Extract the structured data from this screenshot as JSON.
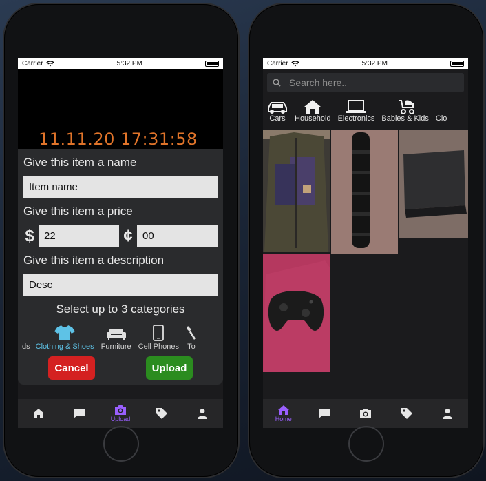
{
  "left_phone": {
    "status": {
      "carrier": "Carrier",
      "time": "5:32 PM"
    },
    "camera_timestamp": "11.11.20 17:31:58",
    "form": {
      "name_label": "Give this item a name",
      "name_value": "Item name",
      "price_label": "Give this item a price",
      "dollar_symbol": "$",
      "dollar_value": "22",
      "cent_symbol": "¢",
      "cent_value": "00",
      "desc_label": "Give this item a description",
      "desc_value": "Desc",
      "categories_label": "Select up to 3 categories",
      "categories": [
        {
          "label": "ds",
          "icon": "none"
        },
        {
          "label": "Clothing & Shoes",
          "icon": "shirt-icon",
          "selected": true
        },
        {
          "label": "Furniture",
          "icon": "sofa-icon"
        },
        {
          "label": "Cell Phones",
          "icon": "phone-icon"
        },
        {
          "label": "To",
          "icon": "tool-icon"
        }
      ],
      "cancel_label": "Cancel",
      "upload_label": "Upload"
    },
    "tabbar": {
      "active_label": "Upload"
    }
  },
  "right_phone": {
    "status": {
      "carrier": "Carrier",
      "time": "5:32 PM"
    },
    "search_placeholder": "Search here..",
    "categories": [
      {
        "label": "Cars",
        "icon": "car-icon"
      },
      {
        "label": "Household",
        "icon": "house-icon"
      },
      {
        "label": "Electronics",
        "icon": "laptop-icon"
      },
      {
        "label": "Babies & Kids",
        "icon": "stroller-icon"
      },
      {
        "label": "Clo",
        "icon": "none"
      }
    ],
    "listings": [
      {
        "subject": "jacket",
        "colors": [
          "#4a4636",
          "#3a3550"
        ]
      },
      {
        "subject": "foam-roller",
        "colors": [
          "#9a7b74",
          "#111111"
        ]
      },
      {
        "subject": "laptop",
        "colors": [
          "#7e6d66",
          "#2d2d2f"
        ]
      },
      {
        "subject": "game-controller",
        "colors": [
          "#b5385f",
          "#1d1d1d"
        ]
      }
    ],
    "tabbar": {
      "active_label": "Home"
    }
  },
  "colors": {
    "accent": "#9a5fff",
    "selected_category": "#5ec2e6",
    "cancel": "#d42121",
    "upload": "#2b8c1f",
    "timestamp": "#e0742a"
  }
}
